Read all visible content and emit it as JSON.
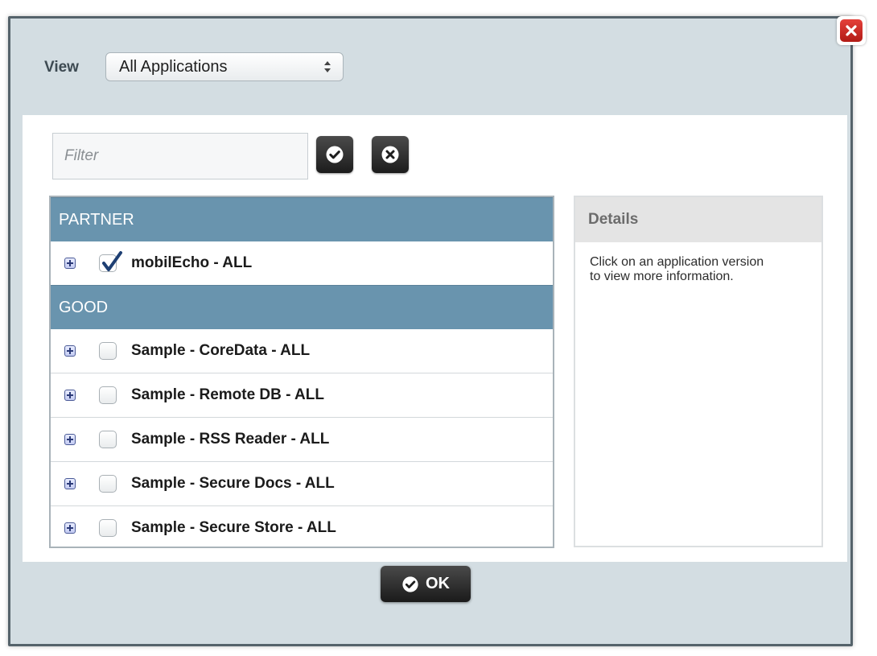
{
  "header": {
    "view_label": "View",
    "view_select": {
      "selected": "All Applications"
    }
  },
  "filter": {
    "placeholder": "Filter",
    "apply_icon": "check-circle-icon",
    "clear_icon": "x-circle-icon"
  },
  "groups": [
    {
      "name": "PARTNER",
      "apps": [
        {
          "label": "mobilEcho - ALL",
          "checked": true
        }
      ]
    },
    {
      "name": "GOOD",
      "apps": [
        {
          "label": "Sample - CoreData - ALL",
          "checked": false
        },
        {
          "label": "Sample - Remote DB - ALL",
          "checked": false
        },
        {
          "label": "Sample - RSS Reader - ALL",
          "checked": false
        },
        {
          "label": "Sample - Secure Docs - ALL",
          "checked": false
        },
        {
          "label": "Sample - Secure Store - ALL",
          "checked": false
        }
      ]
    }
  ],
  "details": {
    "title": "Details",
    "text": "Click on an application version to view more information."
  },
  "footer": {
    "ok_label": "OK"
  },
  "colors": {
    "group_header": "#6994ae",
    "dialog_bg": "#d3dde2",
    "close_red": "#d22c27"
  }
}
